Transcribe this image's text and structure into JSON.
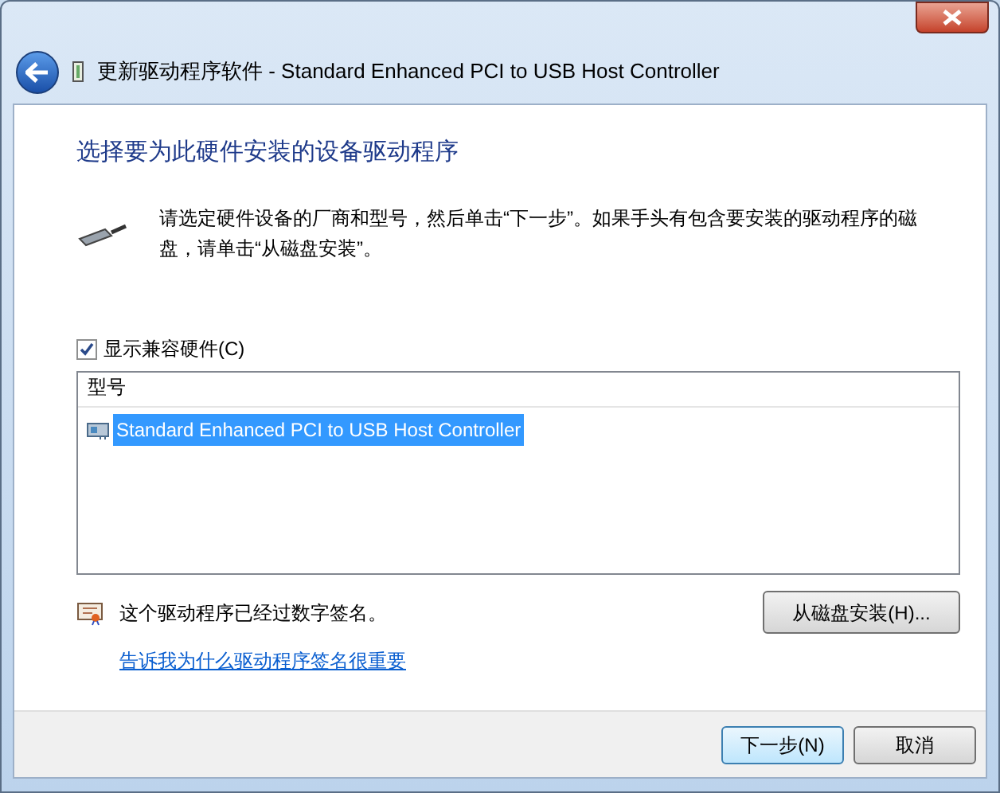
{
  "window": {
    "title": "更新驱动程序软件 - Standard Enhanced PCI to USB Host Controller"
  },
  "heading": "选择要为此硬件安装的设备驱动程序",
  "description": "请选定硬件设备的厂商和型号，然后单击“下一步”。如果手头有包含要安装的驱动程序的磁盘，请单击“从磁盘安装”。",
  "show_compatible": {
    "label": "显示兼容硬件(C)",
    "checked": true
  },
  "model_list": {
    "columns": [
      "型号"
    ],
    "rows": [
      {
        "label": "Standard Enhanced PCI to USB Host Controller",
        "selected": true
      }
    ]
  },
  "signature_note": "这个驱动程序已经过数字签名。",
  "signature_link": "告诉我为什么驱动程序签名很重要",
  "have_disk_button": "从磁盘安装(H)...",
  "footer_buttons": [
    {
      "label": "下一步(N)",
      "default": true
    },
    {
      "label": "取消",
      "default": false
    }
  ]
}
